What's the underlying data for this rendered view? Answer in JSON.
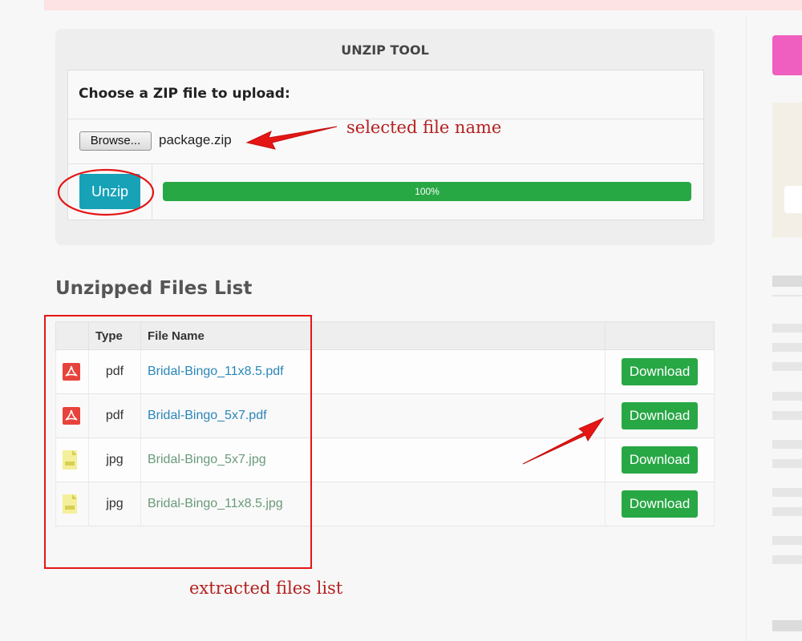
{
  "tool": {
    "title": "UNZIP TOOL",
    "choose_label": "Choose a ZIP file to upload:",
    "browse_label": "Browse...",
    "selected_file": "package.zip",
    "unzip_label": "Unzip",
    "progress_text": "100%",
    "progress_value": 100
  },
  "list": {
    "heading": "Unzipped Files List",
    "columns": [
      "",
      "Type",
      "File Name",
      ""
    ],
    "rows": [
      {
        "icon": "pdf-file-icon",
        "type": "pdf",
        "name": "Bridal-Bingo_11x8.5.pdf",
        "action": "Download"
      },
      {
        "icon": "pdf-file-icon",
        "type": "pdf",
        "name": "Bridal-Bingo_5x7.pdf",
        "action": "Download"
      },
      {
        "icon": "jpg-file-icon",
        "type": "jpg",
        "name": "Bridal-Bingo_5x7.jpg",
        "action": "Download"
      },
      {
        "icon": "jpg-file-icon",
        "type": "jpg",
        "name": "Bridal-Bingo_11x8.5.jpg",
        "action": "Download"
      }
    ]
  },
  "annotations": {
    "selected": "selected file name",
    "extracted": "extracted files list"
  },
  "colors": {
    "accent": "#17a2b8",
    "success": "#28a745",
    "annotation": "#e51616"
  }
}
